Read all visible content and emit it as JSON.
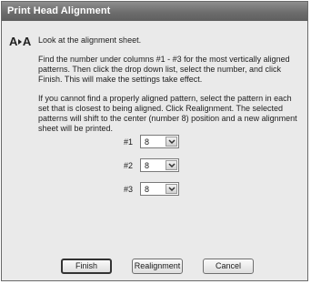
{
  "window": {
    "title": "Print Head Alignment"
  },
  "icon": {
    "name": "alignment-aa-icon",
    "glyph_left": "A",
    "glyph_right": "A"
  },
  "instructions": {
    "line1": "Look at the alignment sheet.",
    "para2": "Find the number under columns #1 - #3 for the most vertically aligned patterns. Then click the drop down list, select the number, and click Finish. This will make the settings take effect.",
    "para3": "If you cannot find a properly aligned pattern, select the pattern in each set that is closest to being aligned. Click Realignment. The selected patterns will shift to the center (number 8) position and a new alignment sheet will be printed."
  },
  "selectors": [
    {
      "label": "#1",
      "value": "8"
    },
    {
      "label": "#2",
      "value": "8"
    },
    {
      "label": "#3",
      "value": "8"
    }
  ],
  "buttons": {
    "finish": "Finish",
    "realignment": "Realignment",
    "cancel": "Cancel"
  }
}
